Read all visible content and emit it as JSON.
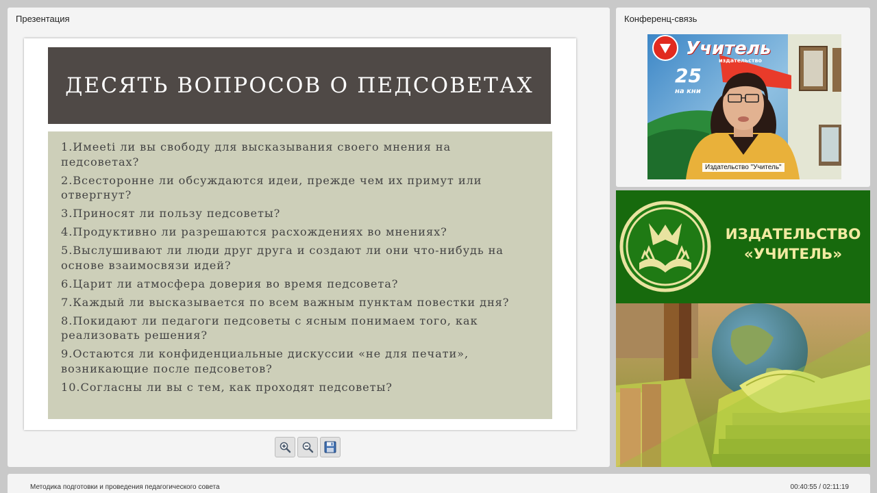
{
  "presentation": {
    "title": "Презентация",
    "slide": {
      "title": "ДЕСЯТЬ ВОПРОСОВ О ПЕДСОВЕТАХ",
      "questions": [
        [
          "1.Имееti ли вы свободу для высказывания своего мнения на",
          "педсоветах?"
        ],
        [
          "2.Всесторонне ли обсуждаются идеи, прежде чем их примут или",
          "отвергнут?"
        ],
        [
          "3.Приносят ли пользу педсоветы?"
        ],
        [
          "4.Продуктивно ли разрешаются расхождениях во мнениях?"
        ],
        [
          "5.Выслушивают ли люди друг друга и создают ли они что-нибудь на",
          "основе взаимосвязи идей?"
        ],
        [
          "6.Царит ли атмосфера доверия во время педсовета?"
        ],
        [
          "7.Каждый ли высказывается по всем важным пунктам повестки дня?"
        ],
        [
          "8.Покидают ли педагоги педсоветы с ясным понимаем того, как",
          "реализовать решения?"
        ],
        [
          "9.Остаются ли конфиденциальные дискуссии «не для печати»,",
          "возникающие после педсоветов?"
        ],
        [
          "10.Согласны ли вы с тем, как проходят педсоветы?"
        ]
      ]
    },
    "toolbar": {
      "zoom_in_icon": "zoom-in-icon",
      "zoom_out_icon": "zoom-out-icon",
      "save_icon": "floppy-disk-icon"
    }
  },
  "conference": {
    "title": "Конференц-связь",
    "speaker_label": "Издательство \"Учитель\"",
    "backdrop": {
      "brand": "Учитель",
      "sub": "издательство",
      "years": "25",
      "tagline": "на кни"
    }
  },
  "publisher": {
    "name_line1": "ИЗДАТЕЛЬСТВО",
    "name_line2": "«УЧИТЕЛЬ»",
    "colors": {
      "green": "#176a0d",
      "text": "#f2eaa2"
    }
  },
  "footer": {
    "course_title": "Методика подготовки и проведения педагогического совета",
    "elapsed": "00:40:55",
    "total": "02:11:19"
  }
}
